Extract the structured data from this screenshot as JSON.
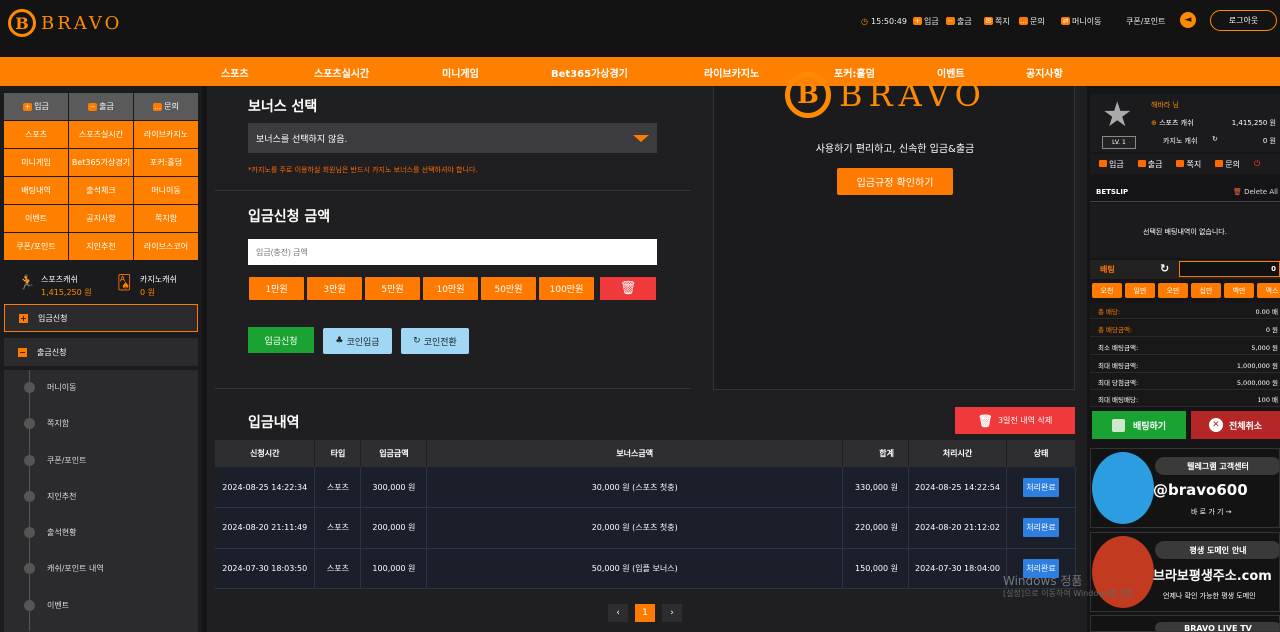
{
  "header": {
    "brand": "BRAVO",
    "time": "15:50:49",
    "links": [
      "입금",
      "출금",
      "쪽지",
      "문의",
      "머니이동"
    ],
    "coupon": "쿠폰/포인트",
    "logout": "로그아웃"
  },
  "nav": [
    "스포츠",
    "스포츠실시간",
    "미니게임",
    "Bet365가상경기",
    "라이브카지노",
    "포커:홀덤",
    "이벤트",
    "공지사항"
  ],
  "left": {
    "top_buttons": [
      "입금",
      "출금",
      "문의"
    ],
    "grid": [
      "스포츠",
      "스포츠실시간",
      "라이브카지노",
      "미니게임",
      "Bet365가상경기",
      "포커:홀덤",
      "배팅내역",
      "출석체크",
      "머니이동",
      "이벤트",
      "공지사항",
      "쪽지함",
      "쿠폰/포인트",
      "지인추천",
      "라이브스코어"
    ],
    "sports_cash_label": "스포츠캐쉬",
    "sports_cash_value": "1,415,250 원",
    "casino_cash_label": "카지노캐쉬",
    "casino_cash_value": "0 원",
    "deposit_request": "입금신청",
    "withdraw_request": "출금신청",
    "items": [
      "머니이동",
      "쪽지함",
      "쿠폰/포인트",
      "지인추천",
      "출석현황",
      "캐쉬/포인트 내역",
      "이벤트"
    ]
  },
  "main": {
    "bonus_title": "보너스 선택",
    "bonus_selected": "보너스를 선택하지 않음.",
    "bonus_warning": "*카지노를 주로 이용하실 회원님은 반드시 카지노 보너스를 선택하셔야 합니다.",
    "amount_title": "입금신청 금액",
    "amount_placeholder": "입금(충전) 금액",
    "amount_buttons": [
      "1만원",
      "3만원",
      "5만원",
      "10만원",
      "50만원",
      "100만원"
    ],
    "submit": "입금신청",
    "coin_deposit": "코인입금",
    "coin_convert": "코인전환",
    "panel_brand": "BRAVO",
    "panel_text": "사용하기 편리하고, 신속한 입금&출금",
    "panel_button": "입금규정 확인하기",
    "history_title": "입금내역",
    "delete_old": "3일전 내역 삭제",
    "columns": [
      "신청시간",
      "타입",
      "입금금액",
      "보너스금액",
      "합계",
      "처리시간",
      "상태"
    ],
    "rows": [
      [
        "2024-08-25 14:22:34",
        "스포츠",
        "300,000 원",
        "30,000 원 (스포츠 첫충)",
        "330,000 원",
        "2024-08-25 14:22:54",
        "처리완료"
      ],
      [
        "2024-08-20 21:11:49",
        "스포츠",
        "200,000 원",
        "20,000 원 (스포츠 첫충)",
        "220,000 원",
        "2024-08-20 21:12:02",
        "처리완료"
      ],
      [
        "2024-07-30 18:03:50",
        "스포츠",
        "100,000 원",
        "50,000 원 (입플 보너스)",
        "150,000 원",
        "2024-07-30 18:04:00",
        "처리완료"
      ]
    ],
    "page_prev": "‹",
    "page_current": "1",
    "page_next": "›"
  },
  "watermark": {
    "line1": "Windows 정품",
    "line2": "[설정]으로 이동하여 Windows를 정품"
  },
  "right": {
    "level": "LV. 1",
    "user": "해바라 님",
    "sports_cash_label": "스포츠 캐쉬",
    "sports_cash_value": "1,415,250 원",
    "casino_cash_label": "카지노 캐쉬",
    "casino_cash_value": "0 원",
    "menu": [
      "입금",
      "출금",
      "쪽지",
      "문의"
    ],
    "betslip": "BETSLIP",
    "delete_all": "Delete All",
    "empty": "선택된 배팅내역이 없습니다.",
    "bet_label": "배팅",
    "bet_value": "0",
    "chips": [
      "오천",
      "일만",
      "오만",
      "십만",
      "백만",
      "맥스"
    ],
    "info": [
      [
        "총 배당:",
        "0.00 배"
      ],
      [
        "총 배당금액:",
        "0 원"
      ],
      [
        "최소 배팅금액:",
        "5,000 원"
      ],
      [
        "최대 배팅금액:",
        "1,000,000 원"
      ],
      [
        "최대 당첨금액:",
        "5,000,000 원"
      ],
      [
        "최대 배팅배당:",
        "100 배"
      ]
    ],
    "bet_button": "배팅하기",
    "cancel_button": "전체취소",
    "banner1_tag": "텔레그램 고객센터",
    "banner1_big": "@bravo600",
    "banner1_small": "바 로 가 기 →",
    "banner2_tag": "평생 도메인 안내",
    "banner2_big": "브라보평생주소.com",
    "banner2_small": "언제나 확인 가능한 평생 도메인",
    "banner3_tag": "BRAVO LIVE TV"
  }
}
